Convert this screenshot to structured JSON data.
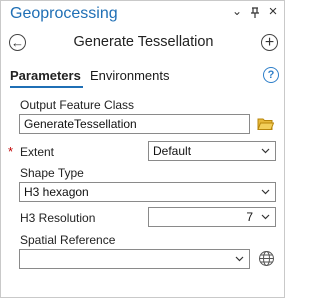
{
  "pane": {
    "title": "Geoprocessing",
    "controls": {
      "options": "⌄",
      "pin": "⊥",
      "close": "×"
    }
  },
  "toolbar": {
    "back_icon": "←",
    "title": "Generate Tessellation",
    "add_icon": "+"
  },
  "tabs": [
    {
      "label": "Parameters",
      "active": true
    },
    {
      "label": "Environments",
      "active": false
    }
  ],
  "help": {
    "glyph": "?"
  },
  "params": {
    "output_feature_class": {
      "label": "Output Feature Class",
      "value": "GenerateTessellation"
    },
    "extent": {
      "required_mark": "*",
      "label": "Extent",
      "value": "Default"
    },
    "shape_type": {
      "label": "Shape Type",
      "value": "H3 hexagon"
    },
    "h3_resolution": {
      "label": "H3 Resolution",
      "value": "7"
    },
    "spatial_reference": {
      "label": "Spatial Reference",
      "value": ""
    }
  },
  "colors": {
    "accent": "#1f6fb5",
    "required": "#c00000",
    "folder": "#d9a514"
  }
}
